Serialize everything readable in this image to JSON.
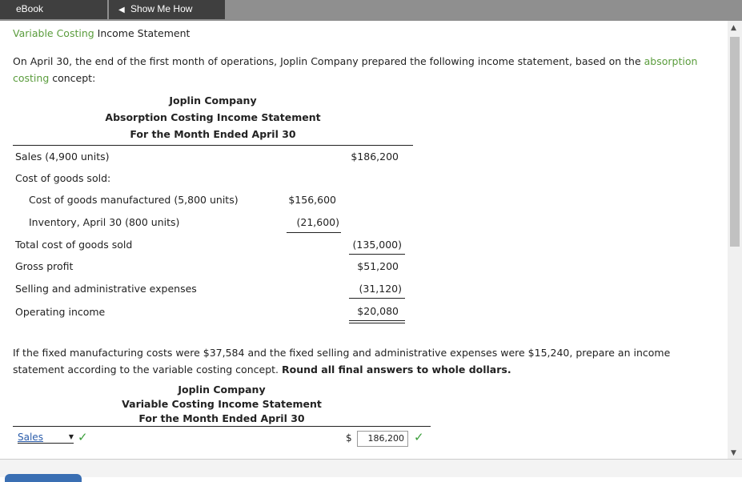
{
  "tabs": {
    "ebook": "eBook",
    "show_me_how": "Show Me How"
  },
  "section_title": {
    "green": "Variable Costing",
    "rest": " Income Statement"
  },
  "intro": {
    "text": "On April 30, the end of the first month of operations, Joplin Company prepared the following income statement, based on the ",
    "link": "absorption costing",
    "tail": " concept:"
  },
  "absorption": {
    "company": "Joplin Company",
    "title": "Absorption Costing Income Statement",
    "period": "For the Month Ended April 30",
    "rows": [
      {
        "label": "Sales (4,900 units)",
        "col1": "",
        "col2": "$186,200"
      },
      {
        "label": "Cost of goods sold:",
        "col1": "",
        "col2": ""
      },
      {
        "label": "Cost of goods manufactured (5,800 units)",
        "col1": "$156,600",
        "col2": ""
      },
      {
        "label": "Inventory, April 30 (800 units)",
        "col1": "(21,600)",
        "col2": ""
      },
      {
        "label": "Total cost of goods sold",
        "col1": "",
        "col2": "(135,000)"
      },
      {
        "label": "Gross profit",
        "col1": "",
        "col2": "$51,200"
      },
      {
        "label": "Selling and administrative expenses",
        "col1": "",
        "col2": "(31,120)"
      },
      {
        "label": "Operating income",
        "col1": "",
        "col2": "$20,080"
      }
    ]
  },
  "instructions": {
    "text": "If the fixed manufacturing costs were $37,584 and the fixed selling and administrative expenses were $15,240, prepare an income statement according to the variable costing concept. ",
    "bold": "Round all final answers to whole dollars."
  },
  "variable": {
    "company": "Joplin Company",
    "title": "Variable Costing Income Statement",
    "period": "For the Month Ended April 30",
    "select_value": "Sales",
    "currency": "$",
    "input_value": "186,200",
    "check": "✓"
  }
}
